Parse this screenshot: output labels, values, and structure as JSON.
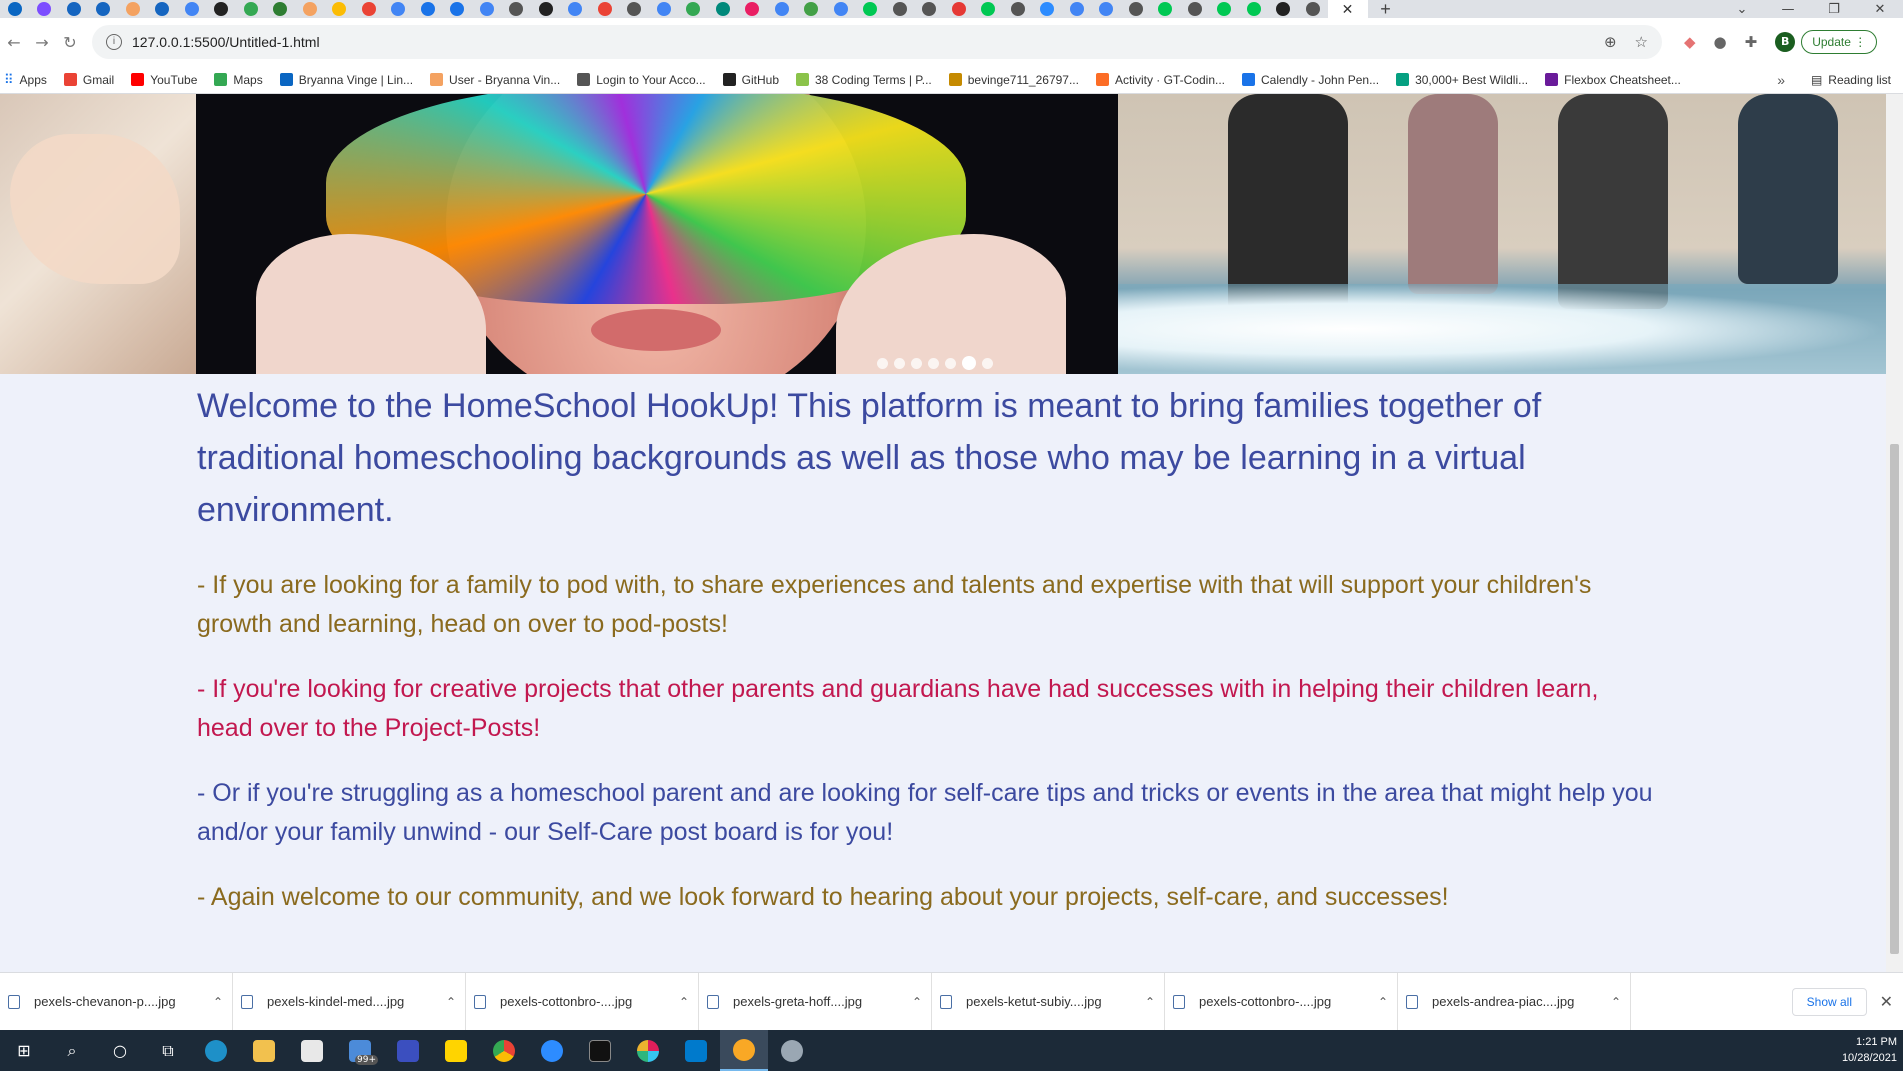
{
  "browser": {
    "active_tab_close": "✕",
    "new_tab": "+",
    "window_controls": [
      "⌄",
      "—",
      "❐",
      "✕"
    ],
    "url": "127.0.0.1:5500/Untitled-1.html",
    "profile_initial": "B",
    "update_label": "Update"
  },
  "bookmarks": {
    "apps": "Apps",
    "items": [
      {
        "label": "Gmail",
        "color": "#ea4335"
      },
      {
        "label": "YouTube",
        "color": "#ff0000"
      },
      {
        "label": "Maps",
        "color": "#34a853"
      },
      {
        "label": "Bryanna Vinge | Lin...",
        "color": "#0a66c2"
      },
      {
        "label": "User - Bryanna Vin...",
        "color": "#f4a261"
      },
      {
        "label": "Login to Your Acco...",
        "color": "#555555"
      },
      {
        "label": "GitHub",
        "color": "#222222"
      },
      {
        "label": "38 Coding Terms | P...",
        "color": "#8bc34a"
      },
      {
        "label": "bevinge711_26797...",
        "color": "#c58a00"
      },
      {
        "label": "Activity · GT-Codin...",
        "color": "#fc6d26"
      },
      {
        "label": "Calendly - John Pen...",
        "color": "#1a73e8"
      },
      {
        "label": "30,000+ Best Wildli...",
        "color": "#05a081"
      },
      {
        "label": "Flexbox Cheatsheet...",
        "color": "#6a1b9a"
      }
    ],
    "more": "»",
    "reading_list": "Reading list"
  },
  "page": {
    "intro": "Welcome to the HomeSchool HookUp! This platform is meant to bring families together of traditional homeschooling backgrounds as well as those who may be learning in a virtual environment.",
    "pods": "- If you are looking for a family to pod with, to share experiences and talents and expertise with that will support your children's growth and learning, head on over to pod-posts!",
    "projects": "- If you're looking for creative projects that other parents and guardians have had successes with in helping their children learn, head over to the Project-Posts!",
    "selfcare": "- Or if you're struggling as a homeschool parent and are looking for self-care tips and tricks or events in the area that might help you and/or your family unwind - our Self-Care post board is for you!",
    "closing": "- Again welcome to our community, and we look forward to hearing about your projects, self-care, and successes!"
  },
  "carousel": {
    "slide_count": 7,
    "active_index": 5
  },
  "downloads": {
    "files": [
      "pexels-chevanon-p....jpg",
      "pexels-kindel-med....jpg",
      "pexels-cottonbro-....jpg",
      "pexels-greta-hoff....jpg",
      "pexels-ketut-subiy....jpg",
      "pexels-cottonbro-....jpg",
      "pexels-andrea-piac....jpg"
    ],
    "show_all": "Show all",
    "close": "✕"
  },
  "taskbar": {
    "mail_badge": "99+",
    "time": "1:21 PM",
    "date": "10/28/2021"
  },
  "colors": {
    "intro_text": "#3c4aa0",
    "gold_text": "#8a6a1e",
    "crimson_text": "#c2184f",
    "page_bg": "#eef1fa"
  }
}
